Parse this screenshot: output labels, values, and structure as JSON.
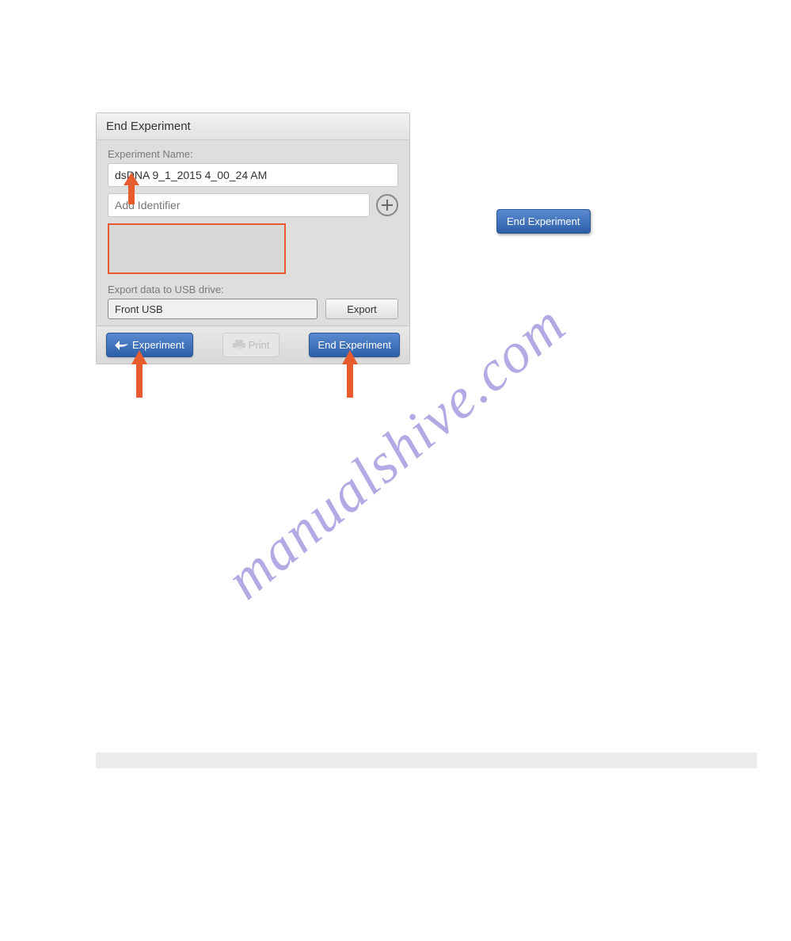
{
  "dialog": {
    "title": "End Experiment",
    "experiment_name_label": "Experiment Name:",
    "experiment_name_value": "dsDNA 9_1_2015 4_00_24 AM",
    "identifier_placeholder": "Add Identifier",
    "export_label": "Export data to USB drive:",
    "usb_value": "Front USB",
    "export_button": "Export",
    "back_button": "Experiment",
    "print_button": "Print",
    "end_button": "End Experiment"
  },
  "standalone": {
    "end_button": "End Experiment"
  },
  "watermark": "manualshive.com"
}
